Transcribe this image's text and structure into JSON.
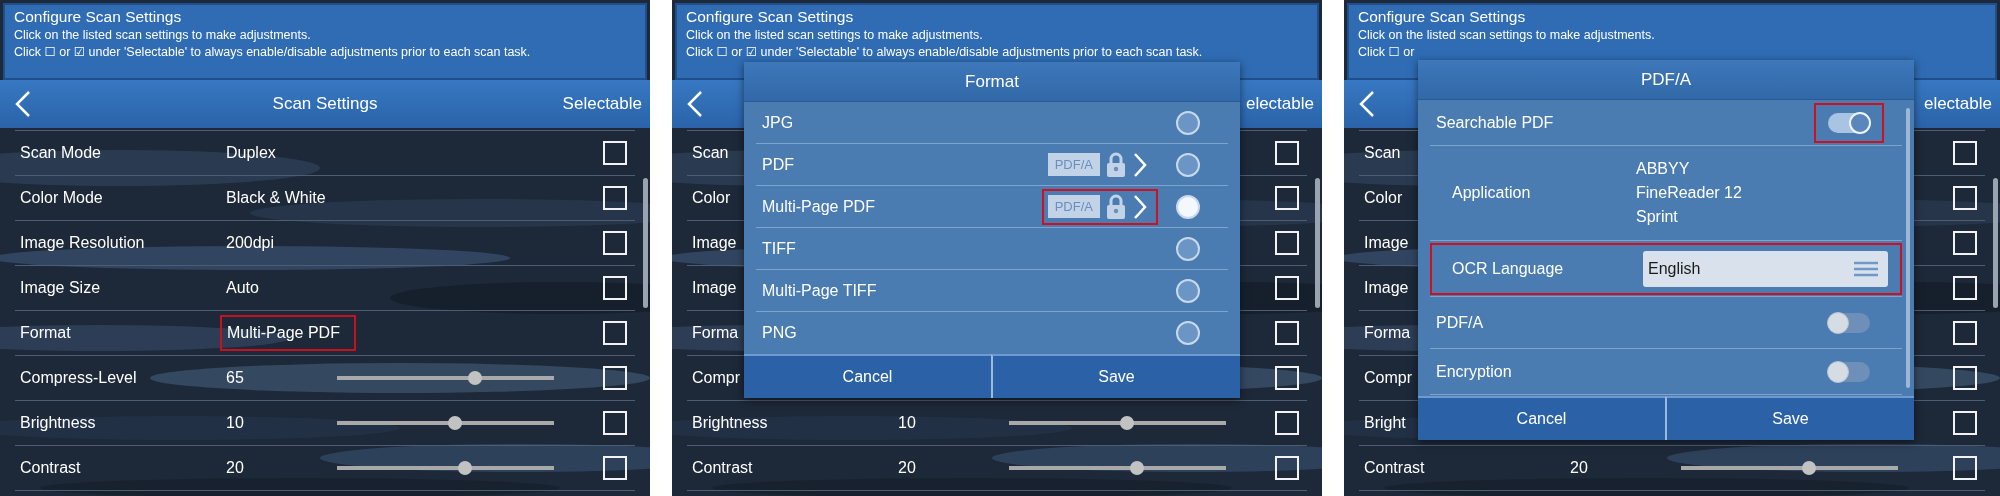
{
  "panels": [
    {
      "header": {
        "title": "Configure Scan Settings",
        "lines": [
          "Click on the listed scan settings to make adjustments.",
          "Click ☐ or ☑ under 'Selectable' to always enable/disable adjustments prior to each scan task."
        ]
      },
      "navbar": {
        "title": "Scan Settings",
        "right": "Selectable"
      },
      "rows": [
        {
          "kind": "text",
          "label": "Scan Mode",
          "value": "Duplex",
          "checked": false,
          "highlighted": false
        },
        {
          "kind": "text",
          "label": "Color Mode",
          "value": "Black & White",
          "checked": false,
          "highlighted": false
        },
        {
          "kind": "text",
          "label": "Image Resolution",
          "value": "200dpi",
          "checked": false,
          "highlighted": false
        },
        {
          "kind": "text",
          "label": "Image Size",
          "value": "Auto",
          "checked": false,
          "highlighted": false
        },
        {
          "kind": "text",
          "label": "Format",
          "value": "Multi-Page PDF",
          "checked": false,
          "highlighted": true
        },
        {
          "kind": "slider",
          "label": "Compress-Level",
          "value": "65",
          "level": 0.645,
          "checked": false,
          "highlighted": false
        },
        {
          "kind": "slider",
          "label": "Brightness",
          "value": "10",
          "level": 0.545,
          "checked": false,
          "highlighted": false
        },
        {
          "kind": "slider",
          "label": "Contrast",
          "value": "20",
          "level": 0.595,
          "checked": false,
          "highlighted": false
        }
      ]
    },
    {
      "header": {
        "title": "Configure Scan Settings",
        "lines": [
          "Click on the listed scan settings to make adjustments.",
          "Click ☐ or ☑ under 'Selectable' to always enable/disable adjustments prior to each scan task."
        ]
      },
      "navbar": {
        "right": "electable"
      },
      "rows": [
        {
          "kind": "text",
          "label": "Scan",
          "checked": false
        },
        {
          "kind": "text",
          "label": "Color",
          "checked": false
        },
        {
          "kind": "text",
          "label": "Image",
          "checked": false
        },
        {
          "kind": "text",
          "label": "Image",
          "checked": false
        },
        {
          "kind": "text",
          "label": "Forma",
          "checked": false
        },
        {
          "kind": "text",
          "label": "Compr",
          "checked": false
        },
        {
          "kind": "slider",
          "label": "Brightness",
          "value": "10",
          "level": 0.545,
          "checked": false
        },
        {
          "kind": "slider",
          "label": "Contrast",
          "value": "20",
          "level": 0.595,
          "checked": false
        }
      ],
      "dialog": {
        "kind": "format",
        "title": "Format",
        "options": [
          {
            "label": "JPG",
            "selected": false
          },
          {
            "label": "PDF",
            "badge": "PDF/A",
            "selected": false,
            "highlighted": false
          },
          {
            "label": "Multi-Page PDF",
            "badge": "PDF/A",
            "selected": true,
            "highlighted": true
          },
          {
            "label": "TIFF",
            "selected": false
          },
          {
            "label": "Multi-Page TIFF",
            "selected": false
          },
          {
            "label": "PNG",
            "selected": false
          }
        ],
        "buttons": [
          "Cancel",
          "Save"
        ]
      }
    },
    {
      "header": {
        "title": "Configure Scan Settings",
        "lines": [
          "Click on the listed scan settings to make adjustments.",
          "Click ☐ or"
        ]
      },
      "navbar": {
        "right": "electable"
      },
      "rows": [
        {
          "kind": "text",
          "label": "Scan",
          "checked": false
        },
        {
          "kind": "text",
          "label": "Color",
          "checked": false
        },
        {
          "kind": "text",
          "label": "Image",
          "checked": false
        },
        {
          "kind": "text",
          "label": "Image",
          "checked": false
        },
        {
          "kind": "text",
          "label": "Forma",
          "checked": false
        },
        {
          "kind": "text",
          "label": "Compr",
          "checked": false
        },
        {
          "kind": "text",
          "label": "Bright",
          "checked": false
        },
        {
          "kind": "slider",
          "label": "Contrast",
          "value": "20",
          "level": 0.595,
          "checked": false
        }
      ],
      "dialog": {
        "kind": "settings",
        "title": "PDF/A",
        "items": [
          {
            "kind": "toggle",
            "label": "Searchable PDF",
            "on": true,
            "highlighted": true
          },
          {
            "kind": "info",
            "label": "Application",
            "lines": [
              "ABBYY",
              "FineReader 12",
              "Sprint"
            ]
          },
          {
            "kind": "select",
            "label": "OCR Language",
            "value": "English",
            "highlighted": true
          },
          {
            "kind": "toggle",
            "label": "PDF/A",
            "on": false,
            "highlighted": false
          },
          {
            "kind": "toggle",
            "label": "Encryption",
            "on": false,
            "highlighted": false
          }
        ],
        "buttons": [
          "Cancel",
          "Save"
        ]
      }
    }
  ]
}
